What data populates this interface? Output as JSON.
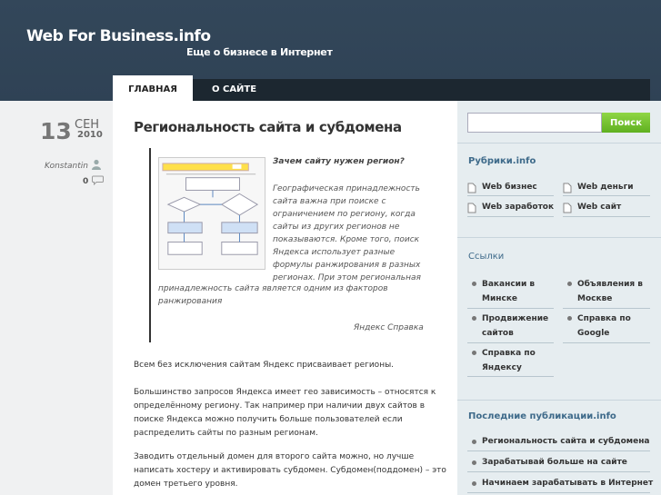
{
  "site": {
    "title": "Web For Business.info",
    "tagline": "Еще о бизнесе в Интернет"
  },
  "nav": {
    "tabs": [
      {
        "label": "Главная"
      },
      {
        "label": "О сайте"
      }
    ]
  },
  "post": {
    "day": "13",
    "month": "Сен",
    "year": "2010",
    "author": "Konstantin",
    "comments": "0",
    "title": "Региональность сайта и субдомена",
    "quote": {
      "title": "Зачем сайту нужен регион?",
      "text1": "Географическая принадлежность сайта важна при поиске с ограничением по региону, когда сайты из других регионов не показываются. Кроме того, поиск Яндекса использует разные формулы ранжирования в разных регионах. При этом региональная",
      "text2": "принадлежность сайта является одним из факторов ранжирования",
      "source": "Яндекс Справка"
    },
    "paragraphs": [
      "Всем без исключения сайтам Яндекс присваивает регионы.",
      "Большинство запросов Яндекса имеет гео зависимость – относятся к определённому региону. Так например при наличии двух сайтов в поиске Яндекса можно получить больше пользователей если распределить сайты по разным регионам.",
      "Заводить отдельный домен для второго сайта можно, но лучше написать хостеру и активировать субдомен. Субдомен(поддомен) – это домен третьего уровня."
    ]
  },
  "sidebar": {
    "search_button": "Поиск",
    "search_value": "",
    "categories_title": "Рубрики.info",
    "categories": [
      "Web бизнес",
      "Web деньги",
      "Web заработок",
      "Web сайт"
    ],
    "links_title": "Ссылки",
    "links": [
      "Вакансии в Минске",
      "Объявления в Москве",
      "Продвижение сайтов",
      "Справка по Google",
      "Справка по Яндексу"
    ],
    "recent_title": "Последние публикации.info",
    "recent": [
      "Региональность сайта и субдомена",
      "Зарабатывай больше на сайте",
      "Начинаем зарабатывать в Интернет"
    ]
  }
}
